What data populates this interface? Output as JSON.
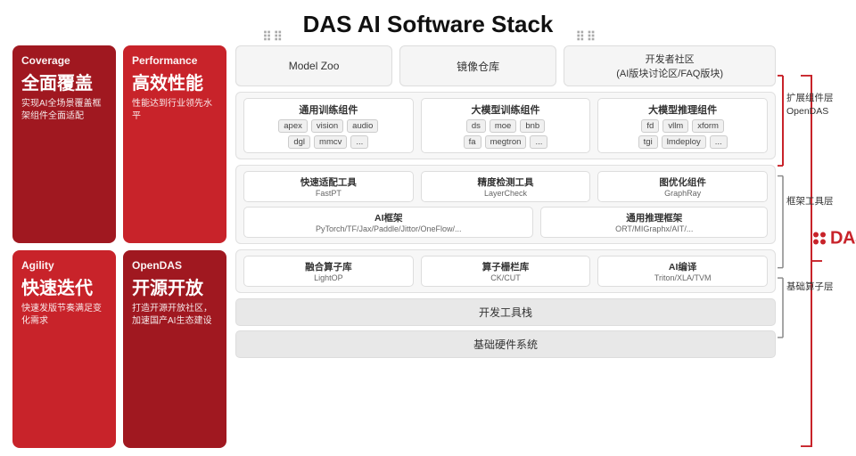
{
  "page": {
    "title": "DAS AI Software Stack"
  },
  "top_row": {
    "items": [
      {
        "id": "model-zoo",
        "label": "Model Zoo"
      },
      {
        "id": "mirror-repo",
        "label": "镜像仓库"
      },
      {
        "id": "dev-community",
        "label": "开发者社区\n(AI版块讨论区/FAQ版块)"
      }
    ]
  },
  "expand_section": {
    "layer_label": "扩展组件层\nOpenDAS",
    "groups": [
      {
        "id": "general-train",
        "title": "通用训练组件",
        "tags_row1": [
          "apex",
          "vision",
          "audio"
        ],
        "tags_row2": [
          "dgl",
          "mmcv",
          "..."
        ]
      },
      {
        "id": "large-train",
        "title": "大模型训练组件",
        "tags_row1": [
          "ds",
          "moe",
          "bnb"
        ],
        "tags_row2": [
          "fa",
          "megtron",
          "..."
        ]
      },
      {
        "id": "large-infer",
        "title": "大模型推理组件",
        "tags_row1": [
          "fd",
          "vllm",
          "xform"
        ],
        "tags_row2": [
          "tgi",
          "lmdeploy",
          "..."
        ]
      }
    ]
  },
  "framework_section": {
    "layer_label": "框架工具层",
    "tools_row": [
      {
        "id": "fastpt",
        "title": "快速适配工具",
        "sub": "FastPT"
      },
      {
        "id": "layercheck",
        "title": "精度检测工具",
        "sub": "LayerCheck"
      },
      {
        "id": "graphray",
        "title": "图优化组件",
        "sub": "GraphRay"
      }
    ],
    "fw_row": [
      {
        "id": "ai-framework",
        "title": "AI框架",
        "sub": "PyTorch/TF/Jax/Paddle/Jittor/OneFlow/..."
      },
      {
        "id": "infer-framework",
        "title": "通用推理框架",
        "sub": "ORT/MIGraphx/AIT/..."
      }
    ]
  },
  "base_section": {
    "layer_label": "基础算子层",
    "items": [
      {
        "id": "fusion-lib",
        "title": "融合算子库",
        "sub": "LightOP"
      },
      {
        "id": "op-lib",
        "title": "算子栅栏库",
        "sub": "CK/CUT"
      },
      {
        "id": "ai-compile",
        "title": "AI编译",
        "sub": "Triton/XLA/TVM"
      }
    ]
  },
  "bottom_bars": [
    {
      "id": "dev-toolchain",
      "label": "开发工具栈"
    },
    {
      "id": "base-hardware",
      "label": "基础硬件系统"
    }
  ],
  "left_cards": {
    "top": [
      {
        "id": "coverage",
        "label": "Coverage",
        "title_zh": "全面覆盖",
        "desc": "实现AI全场景覆盖框架组件全面适配",
        "style": "dark-red"
      },
      {
        "id": "performance",
        "label": "Performance",
        "title_zh": "高效性能",
        "desc": "性能达到行业领先水平",
        "style": "red"
      }
    ],
    "bottom": [
      {
        "id": "agility",
        "label": "Agility",
        "title_zh": "快速迭代",
        "desc": "快速发版节奏满足变化需求",
        "style": "red"
      },
      {
        "id": "opendas",
        "label": "OpenDAS",
        "title_zh": "开源开放",
        "desc": "打造开源开放社区，加速国产AI生态建设",
        "style": "dark-red"
      }
    ]
  },
  "das_logo": {
    "text": "DAS",
    "prefix_dots": "⠿"
  },
  "annotations": {
    "expand_layer": "扩展组件层\nOpenDAS",
    "framework_layer": "框架工具层",
    "base_layer": "基础算子层"
  }
}
